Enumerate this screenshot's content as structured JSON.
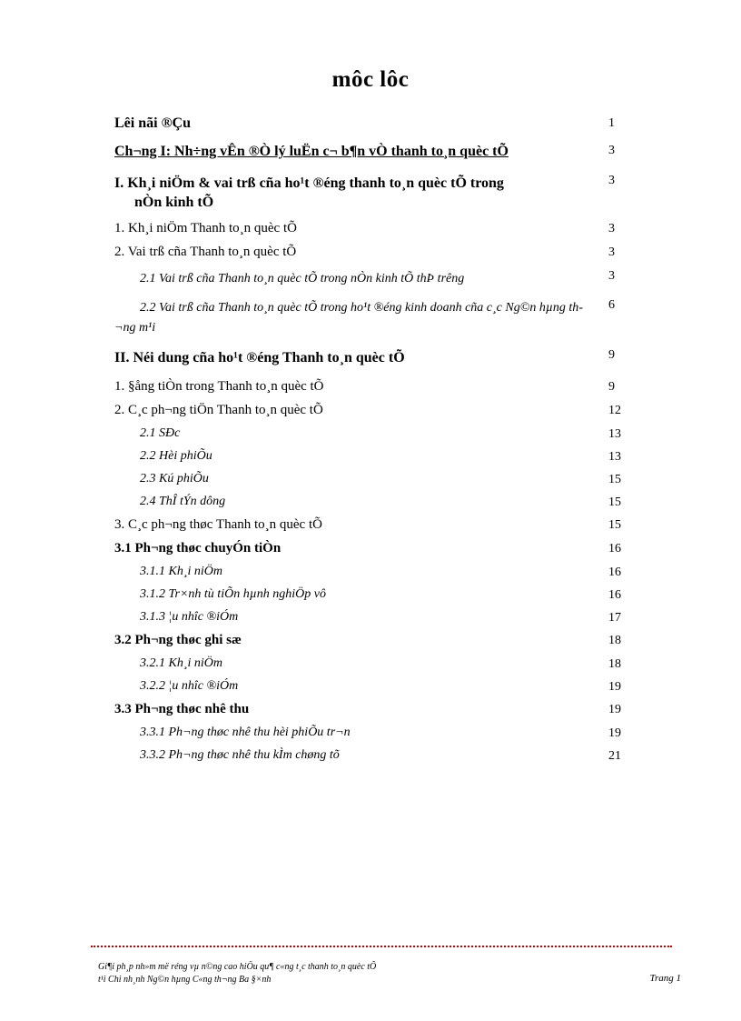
{
  "document": {
    "title": "môc lôc"
  },
  "toc": {
    "entries": [
      {
        "level": "front",
        "text": "Lêi nãi ®Çu",
        "page": "1"
      },
      {
        "level": "chapter",
        "text": "Ch­¬ng  I: Nh÷ng vÊn ®Ò lý luËn c¬ b¶n vÒ thanh to¸n quèc tÕ",
        "page": "3"
      },
      {
        "level": "roman",
        "text": "I. Kh¸i niÖm & vai trß cña ho¹t ®éng thanh to¸n quèc tÕ trong",
        "cont": "nÒn kinh tÕ",
        "page": "3"
      },
      {
        "level": "num",
        "text": "1. Kh¸i niÖm  Thanh to¸n quèc tÕ",
        "page": "3"
      },
      {
        "level": "num",
        "text": "2. Vai trß cña Thanh to¸n quèc tÕ",
        "page": "3"
      },
      {
        "level": "it-wrap",
        "text": "2.1    Vai trß cña  Thanh to¸n  quèc tÕ trong nÒn kinh tÕ thÞ trêng",
        "page": "3"
      },
      {
        "level": "it-wrap",
        "text": "2.2  Vai trß cña Thanh to¸n quèc tÕ trong ho¹t ®éng kinh doanh cña c¸c Ng©n hµng th­¬ng  m¹i",
        "page": "6"
      },
      {
        "level": "roman",
        "text": "II. Néi dung cña ho¹t ®éng Thanh to¸n quèc tÕ",
        "page": "9"
      },
      {
        "level": "num",
        "text": "1. §ång tiÒn trong Thanh to¸n quèc tÕ",
        "page": "9"
      },
      {
        "level": "num",
        "text": "2. C¸c ph­¬ng  tiÖn Thanh to¸n quèc tÕ",
        "page": "12"
      },
      {
        "level": "it",
        "text": "2.1 SÐc",
        "page": "13"
      },
      {
        "level": "it",
        "text": "2.2 Hèi phiÕu",
        "page": "13"
      },
      {
        "level": "it",
        "text": "2.3 Kú phiÕu",
        "page": "15"
      },
      {
        "level": "it",
        "text": "2.4 ThÎ tÝn dông",
        "page": "15"
      },
      {
        "level": "num",
        "text": "3. C¸c ph­¬ng  thøc Thanh to¸n quèc tÕ",
        "page": "15"
      },
      {
        "level": "sub-bold",
        "text": "3.1 Ph­¬ng  thøc chuyÓn tiÒn",
        "page": "16"
      },
      {
        "level": "it-deep",
        "text": "3.1.1 Kh¸i niÖm",
        "page": "16"
      },
      {
        "level": "it-deep",
        "text": "3.1.2  Tr×nh tù tiÕn hµnh nghiÖp vô",
        "page": "16"
      },
      {
        "level": "it-deep",
        "text": "3.1.3 ¦u nh­îc  ®iÓm",
        "page": "17"
      },
      {
        "level": "sub-bold",
        "text": "3.2 Ph­¬ng  thøc ghi sæ",
        "page": "18"
      },
      {
        "level": "it-deep",
        "text": "3.2.1 Kh¸i niÖm",
        "page": "18"
      },
      {
        "level": "it-deep",
        "text": "3.2.2 ¦u nh­îc  ®iÓm",
        "page": "19"
      },
      {
        "level": "sub-bold",
        "text": "3.3 Ph­¬ng  thøc nhê thu",
        "page": "19"
      },
      {
        "level": "it-deep",
        "text": "3.3.1 Ph­¬ng  thøc nhê thu hèi phiÕu tr¬n",
        "page": "19"
      },
      {
        "level": "it-deep",
        "text": "3.3.2 Ph­¬ng  thøc nhê thu kÌm chøng tõ",
        "page": "21"
      }
    ]
  },
  "footer": {
    "line1": "Gi¶i ph¸p nh»m më réng vµ n©ng cao hiÖu qu¶ c«ng t¸c thanh to¸n quèc tÕ",
    "line2": "t¹i Chi nh¸nh Ng©n hµng C«ng th­¬ng  Ba §×nh",
    "page_label": "Trang 1",
    "rule_color": "#c00000"
  }
}
